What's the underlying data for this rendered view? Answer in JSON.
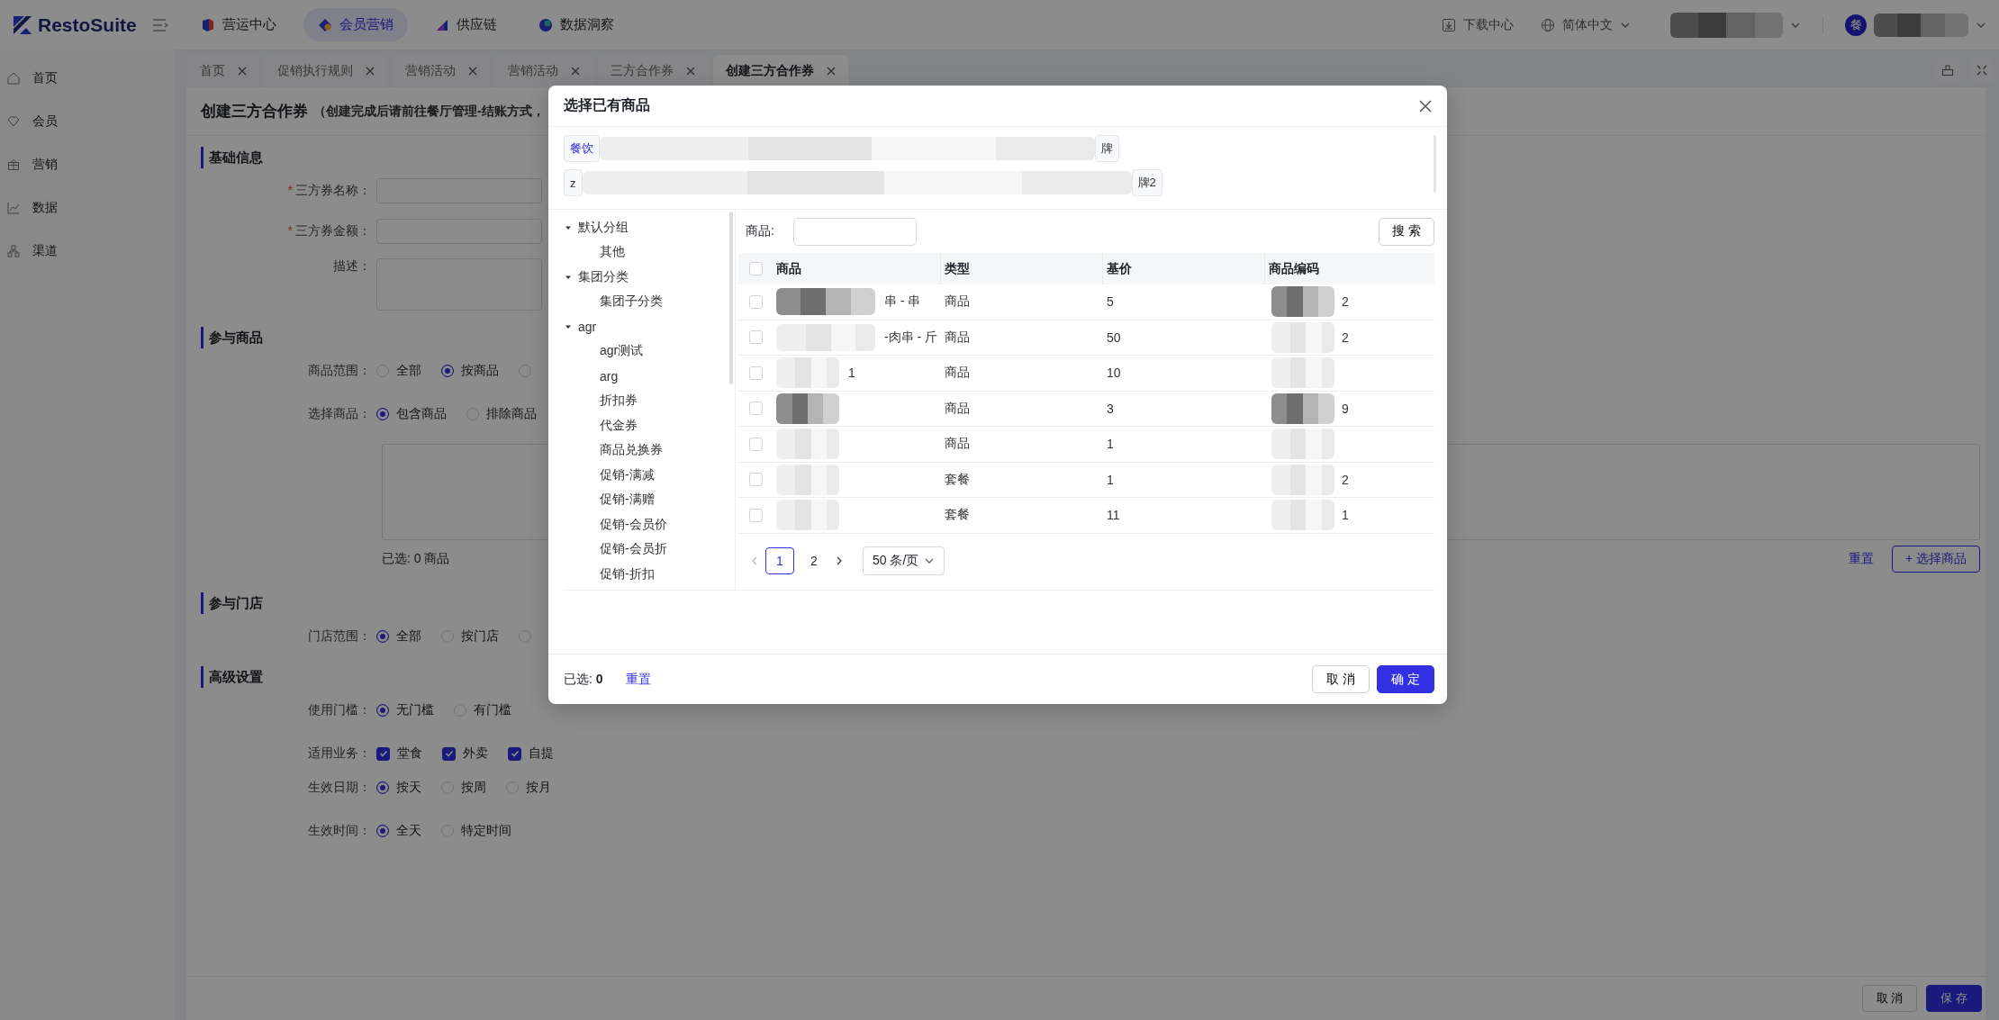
{
  "topbar": {
    "logo": "RestoSuite",
    "nav": [
      {
        "label": "营运中心",
        "selected": false
      },
      {
        "label": "会员营销",
        "selected": true
      },
      {
        "label": "供应链",
        "selected": false
      },
      {
        "label": "数据洞察",
        "selected": false
      }
    ],
    "download": "下载中心",
    "language": "简体中文",
    "avatar": "餐"
  },
  "sidebar": {
    "items": [
      {
        "label": "首页"
      },
      {
        "label": "会员"
      },
      {
        "label": "营销"
      },
      {
        "label": "数据"
      },
      {
        "label": "渠道"
      }
    ]
  },
  "tabs": [
    {
      "label": "首页",
      "selected": false
    },
    {
      "label": "促销执行规则",
      "selected": false
    },
    {
      "label": "营销活动",
      "selected": false
    },
    {
      "label": "营销活动",
      "selected": false
    },
    {
      "label": "三方合作券",
      "selected": false
    },
    {
      "label": "创建三方合作券",
      "selected": true
    }
  ],
  "form": {
    "title": "创建三方合作券",
    "subtitle": "（创建完成后请前往餐厅管理-结账方式，",
    "sections": [
      {
        "title": "基础信息",
        "fields": [
          {
            "kind": "input",
            "label": "三方券名称：",
            "required_mark": "*"
          },
          {
            "kind": "input",
            "label": "三方券金额：",
            "required_mark": "*"
          },
          {
            "kind": "textarea",
            "label": "描述："
          }
        ]
      },
      {
        "title": "参与商品",
        "fields": [
          {
            "kind": "radio",
            "label": "商品范围：",
            "options": [
              {
                "label": "全部",
                "selected": false
              },
              {
                "label": "按商品",
                "selected": true
              },
              {
                "selected": false
              }
            ]
          },
          {
            "kind": "radio",
            "label": "选择商品：",
            "options": [
              {
                "label": "包含商品",
                "selected": true
              },
              {
                "label": "排除商品",
                "selected": false
              }
            ]
          },
          {
            "kind": "picker",
            "summary": "已选: 0 商品",
            "reset": "重置",
            "button": "+ 选择商品"
          }
        ]
      },
      {
        "title": "参与门店",
        "fields": [
          {
            "kind": "radio",
            "label": "门店范围：",
            "options": [
              {
                "label": "全部",
                "selected": true
              },
              {
                "label": "按门店",
                "selected": false
              },
              {
                "selected": false
              }
            ]
          }
        ]
      },
      {
        "title": "高级设置",
        "fields": [
          {
            "kind": "radio",
            "label": "使用门槛：",
            "options": [
              {
                "label": "无门槛",
                "selected": true
              },
              {
                "label": "有门槛",
                "selected": false
              }
            ]
          },
          {
            "kind": "checkbox",
            "label": "适用业务：",
            "options": [
              {
                "label": "堂食",
                "checked": true
              },
              {
                "label": "外卖",
                "checked": true
              },
              {
                "label": "自提",
                "checked": true
              }
            ]
          },
          {
            "kind": "radio",
            "label": "生效日期：",
            "options": [
              {
                "label": "按天",
                "selected": true
              },
              {
                "label": "按周",
                "selected": false
              },
              {
                "label": "按月",
                "selected": false
              }
            ]
          },
          {
            "kind": "radio",
            "label": "生效时间：",
            "options": [
              {
                "label": "全天",
                "selected": true
              },
              {
                "label": "特定时间",
                "selected": false
              }
            ]
          }
        ]
      }
    ],
    "footer": {
      "cancel": "取 消",
      "save": "保 存"
    }
  },
  "dialog": {
    "title": "选择已有商品",
    "tag_rows": [
      {
        "tags": [
          {
            "label": "餐饮",
            "selected": true
          },
          {
            "label": "牌",
            "selected": false
          }
        ]
      },
      {
        "tags": [
          {
            "label": "z",
            "selected": false
          },
          {
            "label": "牌2",
            "selected": false
          }
        ]
      }
    ],
    "tree": [
      {
        "label": "默认分组",
        "expanded": true,
        "children": [
          {
            "label": "其他"
          }
        ]
      },
      {
        "label": "集团分类",
        "expanded": true,
        "children": [
          {
            "label": "集团子分类"
          }
        ]
      },
      {
        "label": "agr",
        "expanded": true,
        "children": [
          {
            "label": "agr测试"
          },
          {
            "label": "arg"
          },
          {
            "label": "折扣券"
          },
          {
            "label": "代金券"
          },
          {
            "label": "商品兑换券"
          },
          {
            "label": "促销-满减"
          },
          {
            "label": "促销-满赠"
          },
          {
            "label": "促销-会员价"
          },
          {
            "label": "促销-会员折"
          },
          {
            "label": "促销-折扣"
          }
        ]
      }
    ],
    "search": {
      "label": "商品:",
      "button": "搜 索"
    },
    "table": {
      "all_checked": false,
      "columns": [
        "商品",
        "类型",
        "基价",
        "商品编码"
      ],
      "rows": [
        {
          "checked": false,
          "cells": [
            "串 - 串",
            "商品",
            "5",
            "2"
          ]
        },
        {
          "checked": false,
          "cells": [
            "-肉串 - 斤",
            "商品",
            "50",
            "2"
          ]
        },
        {
          "checked": false,
          "cells": [
            "1",
            "商品",
            "10",
            ""
          ]
        },
        {
          "checked": false,
          "cells": [
            "",
            "商品",
            "3",
            "9"
          ]
        },
        {
          "checked": false,
          "cells": [
            "",
            "商品",
            "1",
            ""
          ]
        },
        {
          "checked": false,
          "cells": [
            "",
            "套餐",
            "1",
            "2"
          ]
        },
        {
          "checked": false,
          "cells": [
            "",
            "套餐",
            "11",
            "1"
          ]
        }
      ]
    },
    "pagination": {
      "pages": [
        {
          "label": "1",
          "selected": true
        },
        {
          "label": "2",
          "selected": false
        }
      ],
      "page_size": "50 条/页"
    },
    "footer": {
      "selected_label": "已选: **0**",
      "reset": "重置",
      "cancel": "取 消",
      "confirm": "确 定"
    }
  }
}
